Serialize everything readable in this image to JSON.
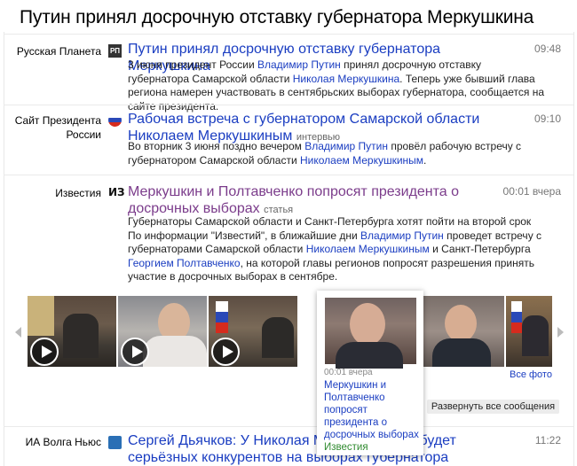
{
  "page": {
    "title": "Путин принял досрочную отставку губернатора Меркушкина"
  },
  "news": [
    {
      "source": "Русская Планета",
      "icon": "РП",
      "headline": "Путин принял досрочную отставку губернатора Меркушкина",
      "kind": "",
      "time": "09:48",
      "snippet": [
        {
          "t": "3 июня президент России "
        },
        {
          "t": "Владимир Путин",
          "link": true
        },
        {
          "t": " принял досрочную отставку губернатора Самарской области "
        },
        {
          "t": "Николая Меркушкина",
          "link": true
        },
        {
          "t": ". Теперь уже бывший глава региона намерен участвовать в сентябрьских выборах губернатора, сообщается на сайте президента."
        }
      ]
    },
    {
      "source": "Сайт Президента России",
      "icon": "",
      "headline": "Рабочая встреча с губернатором Самарской области Николаем Меркушкиным",
      "kind": "интервью",
      "time": "09:10",
      "snippet": [
        {
          "t": "Во вторник 3 июня поздно вечером "
        },
        {
          "t": "Владимир Путин",
          "link": true
        },
        {
          "t": " провёл рабочую встречу с губернатором Самарской области "
        },
        {
          "t": "Николаем Меркушкиным",
          "link": true
        },
        {
          "t": "."
        }
      ]
    },
    {
      "source": "Известия",
      "icon": "ИЗ",
      "headline": "Меркушкин и Полтавченко попросят президента о досрочных выборах",
      "kind": "статья",
      "time": "00:01 вчера",
      "snippet": [
        {
          "t": "Губернаторы Самарской области и Санкт-Петербурга хотят пойти на второй срок По информации \"Известий\", в ближайшие дни "
        },
        {
          "t": "Владимир Путин",
          "link": true
        },
        {
          "t": " проведет встречу с губернаторами Самарской области "
        },
        {
          "t": "Николаем Меркушкиным",
          "link": true
        },
        {
          "t": " и Санкт-Петербурга "
        },
        {
          "t": "Георгием Полтавченко",
          "link": true
        },
        {
          "t": ", на которой главы регионов попросят разрешения принять участие в досрочных выборах в сентябре."
        }
      ]
    },
    {
      "source": "ИА Волга Ньюс",
      "icon": "",
      "headline": "Сергей Дьячков: У Николая Меркушкина не будет серьёзных конкурентов на выборах губернатора",
      "kind": "",
      "time": "11:22"
    }
  ],
  "tooltip": {
    "time": "00:01 вчера",
    "title": "Меркушкин и Полтавченко попросят президента о досрочных выборах",
    "source": "Известия"
  },
  "gallery": {
    "all_photos": "Все фото"
  },
  "expand_button": "Развернуть все сообщения"
}
